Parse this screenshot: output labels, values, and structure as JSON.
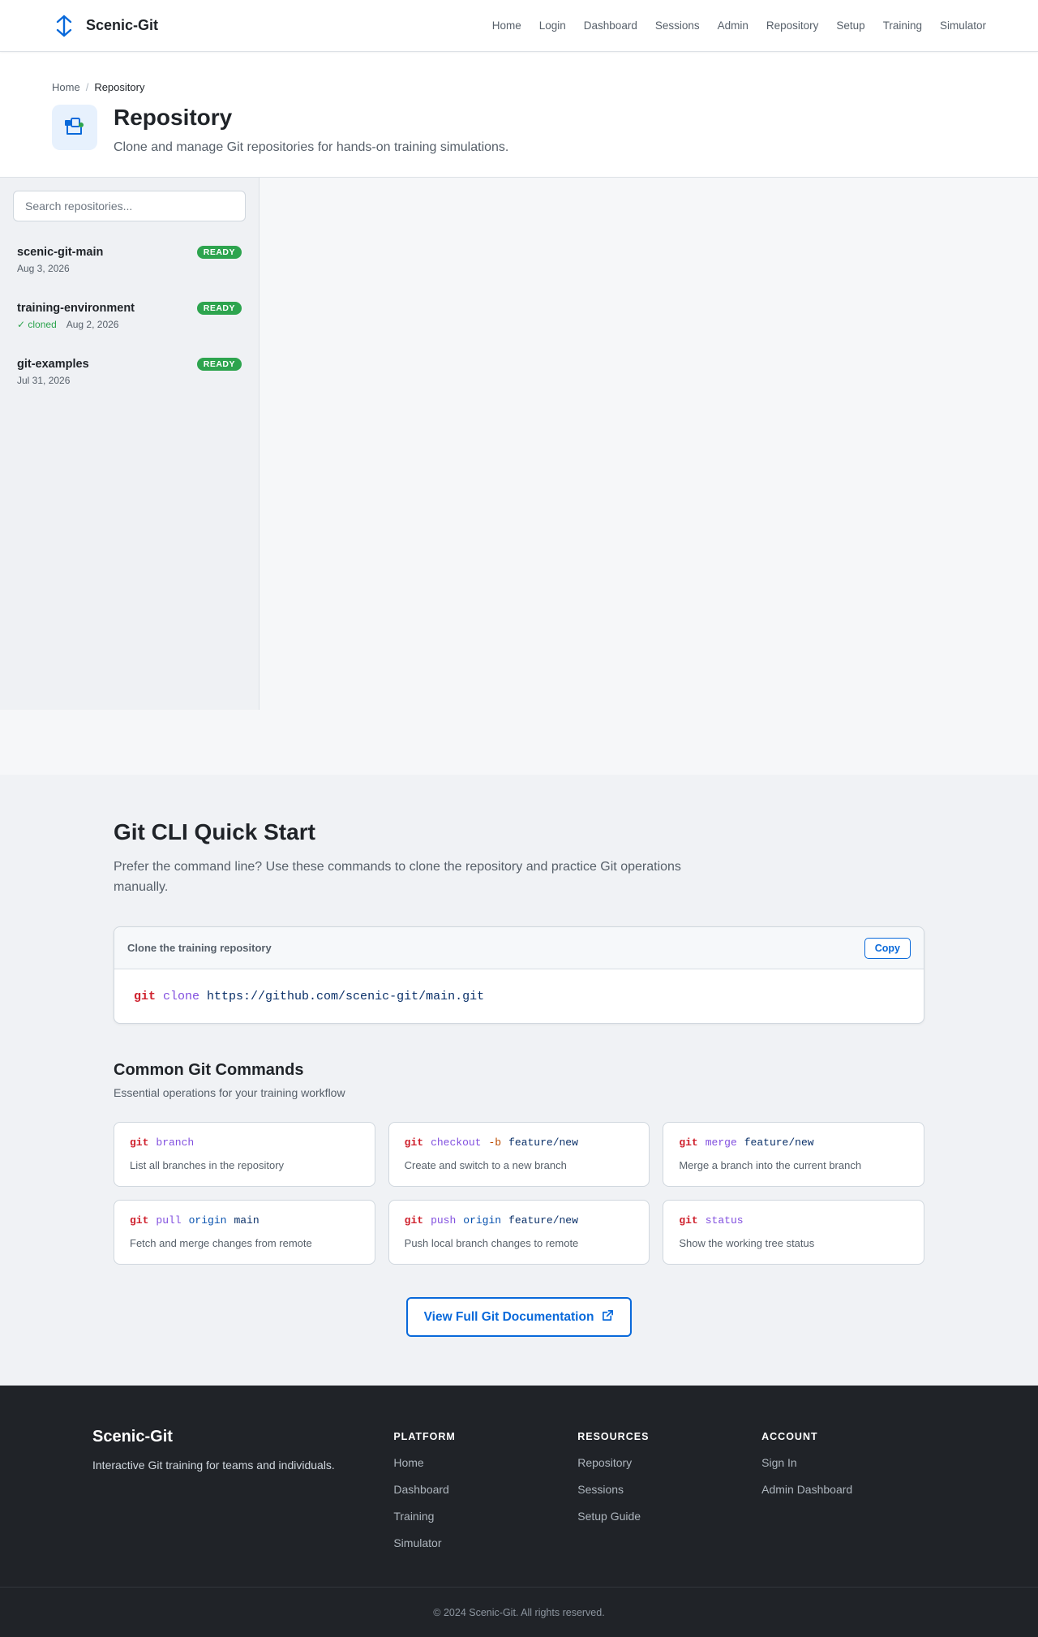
{
  "header": {
    "brand": "Scenic-Git",
    "nav": [
      "Home",
      "Login",
      "Dashboard",
      "Sessions",
      "Admin",
      "Repository",
      "Setup",
      "Training",
      "Simulator"
    ]
  },
  "breadcrumb": {
    "home": "Home",
    "separator": "/",
    "current": "Repository"
  },
  "hero": {
    "title": "Repository",
    "subtitle": "Clone and manage Git repositories for hands-on training simulations."
  },
  "repo_panel": {
    "search_placeholder": "Search repositories...",
    "repos": [
      {
        "name": "scenic-git-main",
        "status": "READY",
        "cloned": "",
        "date": "Aug 3, 2026"
      },
      {
        "name": "training-environment",
        "status": "READY",
        "cloned": "✓ cloned",
        "date": "Aug 2, 2026"
      },
      {
        "name": "git-examples",
        "status": "READY",
        "cloned": "",
        "date": "Jul 31, 2026"
      }
    ]
  },
  "cli": {
    "title": "Git CLI Quick Start",
    "description": "Prefer the command line? Use these commands to clone the repository and practice Git operations manually.",
    "clone_label": "Clone the training repository",
    "copy_label": "Copy",
    "clone_cmd": {
      "git": "git",
      "cmd": "clone",
      "arg": "https://github.com/scenic-git/main.git"
    }
  },
  "common": {
    "title": "Common Git Commands",
    "subtitle": "Essential operations for your training workflow",
    "commands": [
      {
        "git": "git",
        "cmd": "branch",
        "flag": "",
        "remote": "",
        "arg": "",
        "desc": "List all branches in the repository"
      },
      {
        "git": "git",
        "cmd": "checkout",
        "flag": "-b",
        "remote": "",
        "arg": "feature/new",
        "desc": "Create and switch to a new branch"
      },
      {
        "git": "git",
        "cmd": "merge",
        "flag": "",
        "remote": "",
        "arg": "feature/new",
        "desc": "Merge a branch into the current branch"
      },
      {
        "git": "git",
        "cmd": "pull",
        "flag": "",
        "remote": "origin",
        "arg": "main",
        "desc": "Fetch and merge changes from remote"
      },
      {
        "git": "git",
        "cmd": "push",
        "flag": "",
        "remote": "origin",
        "arg": "feature/new",
        "desc": "Push local branch changes to remote"
      },
      {
        "git": "git",
        "cmd": "status",
        "flag": "",
        "remote": "",
        "arg": "",
        "desc": "Show the working tree status"
      }
    ],
    "docs_button": "View Full Git Documentation"
  },
  "footer": {
    "brand": "Scenic-Git",
    "tagline": "Interactive Git training for teams and individuals.",
    "columns": [
      {
        "title": "PLATFORM",
        "links": [
          "Home",
          "Dashboard",
          "Training",
          "Simulator"
        ]
      },
      {
        "title": "RESOURCES",
        "links": [
          "Repository",
          "Sessions",
          "Setup Guide"
        ]
      },
      {
        "title": "ACCOUNT",
        "links": [
          "Sign In",
          "Admin Dashboard"
        ]
      }
    ],
    "copyright": "© 2024 Scenic-Git. All rights reserved."
  },
  "colors": {
    "accent": "#0969da",
    "success": "#2da44e",
    "footer_bg": "#202328"
  },
  "icons": {
    "brand": "split-arrows-icon",
    "hero": "repository-icon",
    "docs": "external-link-icon"
  }
}
